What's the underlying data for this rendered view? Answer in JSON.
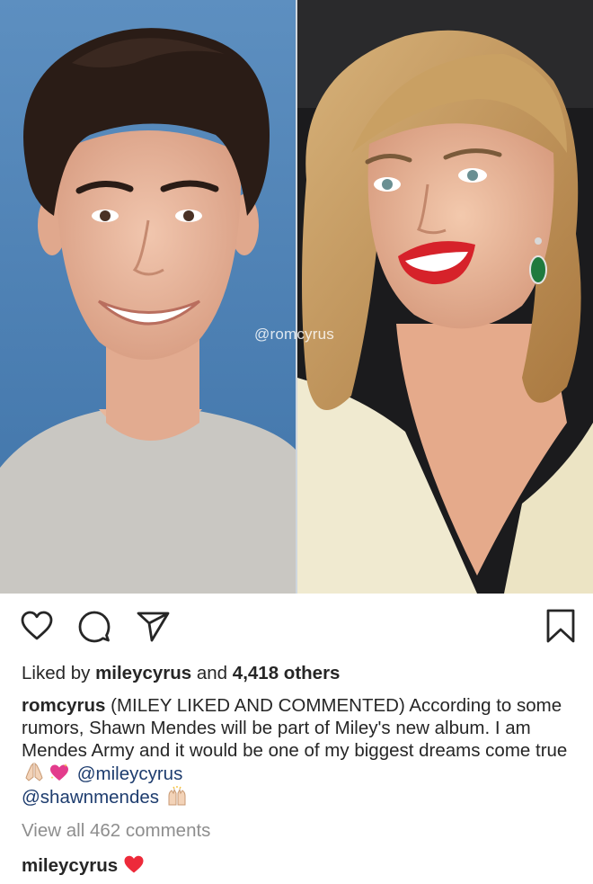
{
  "post": {
    "watermark": "@romcyrus",
    "likes": {
      "prefix": "Liked by ",
      "user": "mileycyrus",
      "middle": " and ",
      "count": "4,418 others"
    },
    "caption": {
      "username": "romcyrus",
      "text": " (MILEY LIKED AND COMMENTED) According to some rumors, Shawn Mendes will be part of Miley's new album. I am Mendes Army and it would be one of my biggest dreams come true ",
      "mention1": "@mileycyrus",
      "mention2": "@shawnmendes"
    },
    "view_all_comments": "View all 462 comments",
    "comment": {
      "username": "mileycyrus"
    },
    "icons": {
      "like": "heart-outline-icon",
      "comment": "comment-bubble-icon",
      "share": "paper-plane-icon",
      "save": "bookmark-icon"
    },
    "colors": {
      "text": "#262626",
      "muted": "#8e8e8e",
      "mention": "#1d3c6e",
      "heart": "#ed2a3a"
    }
  }
}
